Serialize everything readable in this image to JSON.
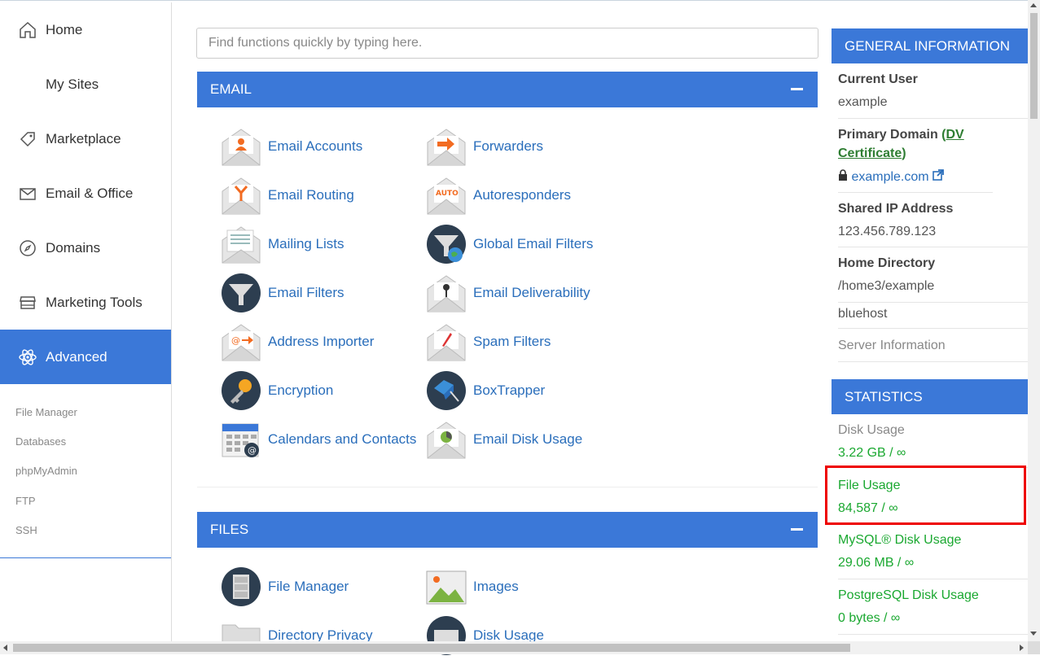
{
  "sidebar": {
    "items": [
      {
        "label": "Home",
        "icon": "home-icon"
      },
      {
        "label": "My Sites",
        "icon": "wordpress-icon"
      },
      {
        "label": "Marketplace",
        "icon": "tag-icon"
      },
      {
        "label": "Email & Office",
        "icon": "envelope-icon"
      },
      {
        "label": "Domains",
        "icon": "compass-icon"
      },
      {
        "label": "Marketing Tools",
        "icon": "store-icon"
      },
      {
        "label": "Advanced",
        "icon": "atom-icon"
      }
    ],
    "sub_items": [
      "File Manager",
      "Databases",
      "phpMyAdmin",
      "FTP",
      "SSH"
    ]
  },
  "search": {
    "placeholder": "Find functions quickly by typing here."
  },
  "email_panel": {
    "title": "EMAIL",
    "items": [
      "Email Accounts",
      "Forwarders",
      "Email Routing",
      "Autoresponders",
      "Mailing Lists",
      "Global Email Filters",
      "Email Filters",
      "Email Deliverability",
      "Address Importer",
      "Spam Filters",
      "Encryption",
      "BoxTrapper",
      "Calendars and Contacts",
      "Email Disk Usage"
    ]
  },
  "files_panel": {
    "title": "FILES",
    "items": [
      "File Manager",
      "Images",
      "Directory Privacy",
      "Disk Usage"
    ]
  },
  "general_info": {
    "title": "GENERAL INFORMATION",
    "current_user_label": "Current User",
    "current_user": "example",
    "primary_domain_label": "Primary Domain",
    "dv_paren_open": "(",
    "dv_label": "DV Certificate",
    "dv_paren_close": ")",
    "primary_domain": "example.com",
    "shared_ip_label": "Shared IP Address",
    "shared_ip": "123.456.789.123",
    "home_dir_label": "Home Directory",
    "home_dir": "/home3/example",
    "host": "bluehost",
    "server_info": "Server Information"
  },
  "statistics": {
    "title": "STATISTICS",
    "disk_usage_label": "Disk Usage",
    "disk_usage": "3.22 GB / ∞",
    "file_usage_label": "File Usage",
    "file_usage": "84,587 / ∞",
    "mysql_label": "MySQL® Disk Usage",
    "mysql": "29.06 MB / ∞",
    "postgres_label": "PostgreSQL Disk Usage",
    "postgres": "0 bytes / ∞"
  },
  "colors": {
    "accent": "#3b78d8",
    "link": "#2a6ebb",
    "stat_green": "#1aa830",
    "highlight": "#e00000"
  }
}
